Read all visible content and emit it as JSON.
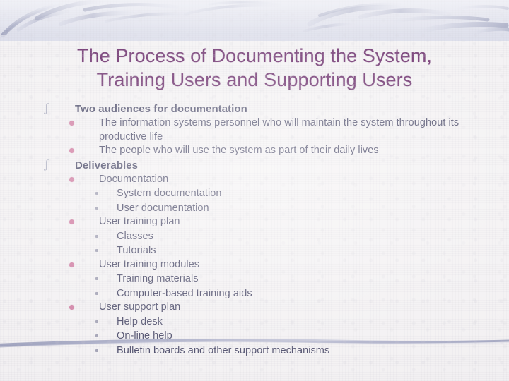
{
  "slide": {
    "title_lines": [
      "The Process of Documenting the System,",
      "Training Users and Supporting Users"
    ],
    "title_color": "#5e1a5e",
    "body_color": "#3e3e5e",
    "band_color": "#d9dbe9",
    "accent_bullet_color": "#d0799f",
    "outline": [
      {
        "level": 1,
        "text": "Two audiences for documentation",
        "bullet": "arc-bullet-icon"
      },
      {
        "level": 2,
        "text": "The information systems personnel who will maintain the system throughout its productive life",
        "bullet": "dot-bullet-icon"
      },
      {
        "level": 2,
        "text": "The people who will use the system as part of their daily lives",
        "bullet": "dot-bullet-icon"
      },
      {
        "level": 1,
        "text": "Deliverables",
        "bullet": "arc-bullet-icon"
      },
      {
        "level": 2,
        "text": "Documentation",
        "bullet": "dot-bullet-icon"
      },
      {
        "level": 3,
        "text": "System documentation",
        "bullet": "square-bullet-icon"
      },
      {
        "level": 3,
        "text": "User documentation",
        "bullet": "square-bullet-icon"
      },
      {
        "level": 2,
        "text": "User training plan",
        "bullet": "dot-bullet-icon"
      },
      {
        "level": 3,
        "text": "Classes",
        "bullet": "square-bullet-icon"
      },
      {
        "level": 3,
        "text": "Tutorials",
        "bullet": "square-bullet-icon"
      },
      {
        "level": 2,
        "text": "User training modules",
        "bullet": "dot-bullet-icon"
      },
      {
        "level": 3,
        "text": "Training materials",
        "bullet": "square-bullet-icon"
      },
      {
        "level": 3,
        "text": "Computer-based training aids",
        "bullet": "square-bullet-icon"
      },
      {
        "level": 2,
        "text": "User support plan",
        "bullet": "dot-bullet-icon"
      },
      {
        "level": 3,
        "text": "Help desk",
        "bullet": "square-bullet-icon"
      },
      {
        "level": 3,
        "text": "On-line help",
        "bullet": "square-bullet-icon"
      },
      {
        "level": 3,
        "text": "Bulletin boards and other support mechanisms",
        "bullet": "square-bullet-icon"
      }
    ]
  }
}
